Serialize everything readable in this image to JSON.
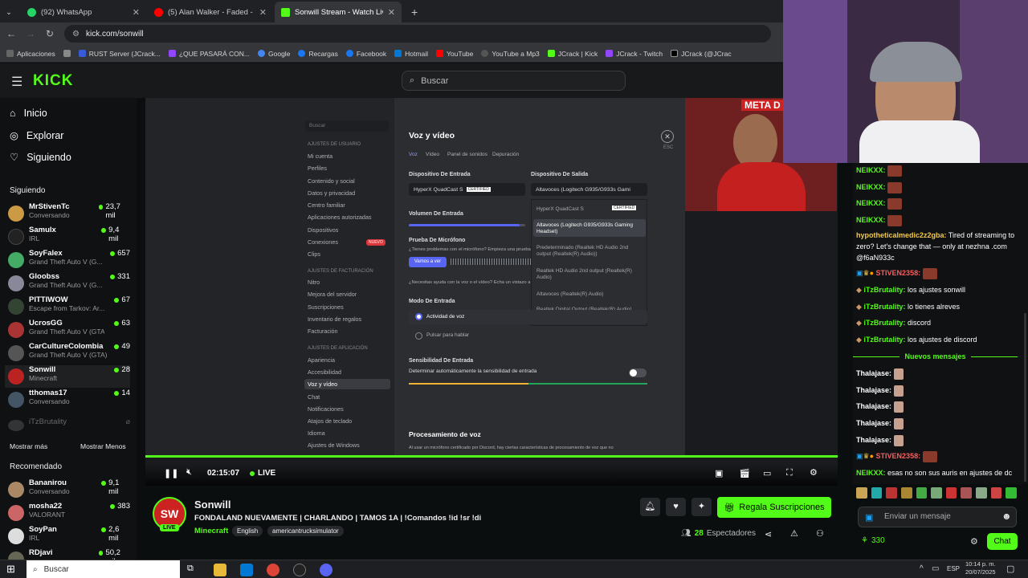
{
  "browser": {
    "tabs": [
      {
        "label": "(92) WhatsApp",
        "color": "#25d366"
      },
      {
        "label": "(5) Alan Walker - Faded - YouTu",
        "color": "#ff0000"
      },
      {
        "label": "Sonwill Stream - Watch Live on",
        "color": "#53fc18"
      }
    ],
    "url": "kick.com/sonwill",
    "bookmarks": [
      "Aplicaciones",
      "RUST Server (JCrack...",
      "¿QUE PASARÁ CON...",
      "Google",
      "Recargas",
      "Facebook",
      "Hotmail",
      "YouTube",
      "YouTube a Mp3",
      "JCrack | Kick",
      "JCrack - Twitch",
      "JCrack (@JCrac"
    ]
  },
  "header": {
    "logo": "KICK",
    "search_placeholder": "Buscar"
  },
  "sidebar": {
    "nav": [
      "Inicio",
      "Explorar",
      "Siguiendo"
    ],
    "following_title": "Siguiendo",
    "following": [
      {
        "name": "MrStivenTc",
        "sub": "Conversando",
        "viewers": "23,7 mil",
        "color": "#c94"
      },
      {
        "name": "Samulx",
        "sub": "IRL",
        "viewers": "9,4 mil",
        "color": "#222"
      },
      {
        "name": "SoyFalex",
        "sub": "Grand Theft Auto V (G...",
        "viewers": "657",
        "color": "#4a6"
      },
      {
        "name": "Gloobss",
        "sub": "Grand Theft Auto V (G...",
        "viewers": "331",
        "color": "#889"
      },
      {
        "name": "PITTIWOW",
        "sub": "Escape from Tarkov: Ar...",
        "viewers": "67",
        "color": "#343"
      },
      {
        "name": "UcrosGG",
        "sub": "Grand Theft Auto V (GTA)",
        "viewers": "63",
        "color": "#a33"
      },
      {
        "name": "CarCultureColombia",
        "sub": "Grand Theft Auto V (GTA)",
        "viewers": "49",
        "color": "#555"
      },
      {
        "name": "Sonwill",
        "sub": "Minecraft",
        "viewers": "28",
        "color": "#b22"
      },
      {
        "name": "tthomas17",
        "sub": "Conversando",
        "viewers": "14",
        "color": "#456"
      }
    ],
    "offline_user": "iTzBrutality",
    "show_more": "Mostrar más",
    "show_less": "Mostrar Menos",
    "recommended_title": "Recomendado",
    "recommended": [
      {
        "name": "Bananirou",
        "sub": "Conversando",
        "viewers": "9,1 mil",
        "color": "#a86"
      },
      {
        "name": "mosha22",
        "sub": "VALORANT",
        "viewers": "383",
        "color": "#c66"
      },
      {
        "name": "SoyPan",
        "sub": "IRL",
        "viewers": "2,6 mil",
        "color": "#ddd"
      },
      {
        "name": "RDjavi",
        "sub": "",
        "viewers": "50,2 mil",
        "color": "#665"
      }
    ]
  },
  "discord": {
    "search": "Buscar",
    "user_settings_header": "AJUSTES DE USUARIO",
    "user_items": [
      "Mi cuenta",
      "Perfiles",
      "Contenido y social",
      "Datos y privacidad",
      "Centro familiar",
      "Aplicaciones autorizadas",
      "Dispositivos",
      "Conexiones",
      "Clips"
    ],
    "new_badge": "NUEVO",
    "billing_header": "AJUSTES DE FACTURACIÓN",
    "billing_items": [
      "Nitro",
      "Mejora del servidor",
      "Suscripciones",
      "Inventario de regalos",
      "Facturación"
    ],
    "app_header": "AJUSTES DE APLICACIÓN",
    "app_items": [
      "Apariencia",
      "Accesibilidad",
      "Voz y vídeo",
      "Chat",
      "Notificaciones",
      "Atajos de teclado",
      "Idioma",
      "Ajustes de Windows"
    ],
    "title": "Voz y vídeo",
    "tabs": [
      "Voz",
      "Vídeo",
      "Panel de sonidos",
      "Depuración"
    ],
    "esc": "ESC",
    "input_device_label": "Dispositivo De Entrada",
    "input_device_value": "HyperX QuadCast S",
    "certified": "CERTIFIED",
    "output_device_label": "Dispositivo De Salida",
    "output_device_value": "Altavoces (Logitech G935/G933s Gami",
    "output_options": [
      "HyperX QuadCast S",
      "Altavoces (Logitech G935/G933s Gaming Headset)",
      "Predeterminado (Realtek HD Audio 2nd output (Realtek(R) Audio))",
      "Realtek HD Audio 2nd output (Realtek(R) Audio)",
      "Altavoces (Realtek(R) Audio)",
      "Realtek Digital Output (Realtek(R) Audio)"
    ],
    "input_volume_label": "Volumen De Entrada",
    "input_volume": 0.95,
    "mic_test_label": "Prueba De Micrófono",
    "mic_test_text": "¿Tienes problemas con el micrófono? Empieza una prueba",
    "mic_test_button": "Vamos a ver",
    "help_text": "¿Necesitas ayuda con la voz o el vídeo? Echa un vistazo a",
    "input_mode_label": "Modo De Entrada",
    "input_modes": [
      "Actividad de voz",
      "Pulsar para hablar"
    ],
    "sensitivity_label": "Sensibilidad De Entrada",
    "sensitivity_auto": "Determinar automáticamente la sensibilidad de entrada",
    "sensitivity": 0.5,
    "processing_label": "Procesamiento de voz",
    "processing_text": "Al usar un micrófono certificado por Discord, hay ciertas características de procesamiento de voz que no"
  },
  "overlay": {
    "facecam_text": "META D"
  },
  "player": {
    "time": "02:15:07",
    "live": "LIVE"
  },
  "stream": {
    "channel": "Sonwill",
    "live_badge": "LIVE",
    "title": "FONDALAND NUEVAMENTE | CHARLANDO  | TAMOS 1A | !Comandos !id !sr !di",
    "category": "Minecraft",
    "tags": [
      "English",
      "americantrucksimulator"
    ],
    "subscribe_label": "Regala Suscripciones",
    "viewers": "28",
    "viewers_label": "Espectadores"
  },
  "chat": {
    "messages": [
      {
        "user": "NEIKXX:",
        "text": ""
      },
      {
        "user": "NEIKXX:",
        "text": ""
      },
      {
        "user": "NEIKXX:",
        "text": ""
      },
      {
        "user": "NEIKXX:",
        "text": ""
      },
      {
        "user": "hypotheticalmedic2z2gba:",
        "text": "Tired of streaming to zero? Let's change that — only at nezhna .com @f6aN933c"
      },
      {
        "user": "STIVEN2358:",
        "text": ""
      },
      {
        "user": "iTzBrutality:",
        "text": "los ajustes sonwill"
      },
      {
        "user": "iTzBrutality:",
        "text": "lo tienes alreves"
      },
      {
        "user": "iTzBrutality:",
        "text": "discord"
      },
      {
        "user": "iTzBrutality:",
        "text": "los ajustes de discord"
      },
      {
        "user": "Thalajase:",
        "text": ""
      },
      {
        "user": "Thalajase:",
        "text": ""
      },
      {
        "user": "Thalajase:",
        "text": ""
      },
      {
        "user": "Thalajase:",
        "text": ""
      },
      {
        "user": "Thalajase:",
        "text": ""
      },
      {
        "user": "STIVEN2358:",
        "text": ""
      },
      {
        "user": "NEIKXX:",
        "text": "esas no son sus auris en ajustes de dc"
      }
    ],
    "new_messages": "Nuevos mensajes",
    "input_placeholder": "Enviar un mensaje",
    "points": "330",
    "chat_button": "Chat"
  },
  "taskbar": {
    "search": "Buscar",
    "lang": "ESP",
    "time": "10:14 p. m.",
    "date": "20/07/2025"
  }
}
